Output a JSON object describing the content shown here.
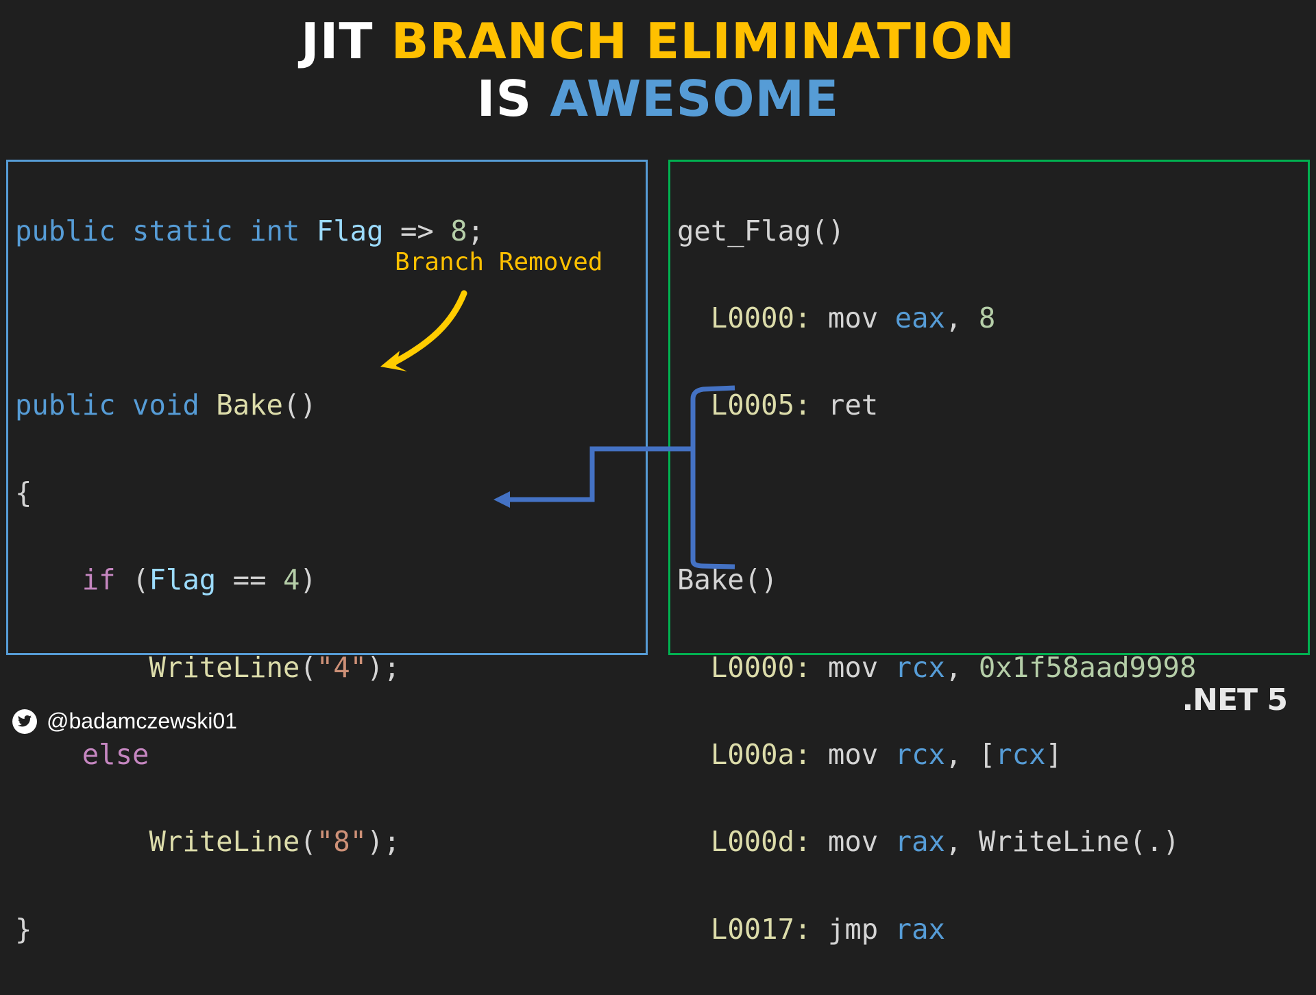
{
  "title": {
    "line1": [
      {
        "text": "JIT",
        "color": "#ffffff"
      },
      {
        "text": "BRANCH ELIMINATION",
        "color": "#ffc000"
      }
    ],
    "line2": [
      {
        "text": "IS",
        "color": "#ffffff"
      },
      {
        "text": "AWESOME",
        "color": "#569cd6"
      }
    ]
  },
  "csharp": {
    "line1": {
      "kw1": "public",
      "kw2": "static",
      "kw3": "int",
      "prop": "Flag",
      "op": "=>",
      "num": "8",
      "end": ";"
    },
    "line3": {
      "kw1": "public",
      "kw2": "void",
      "fn": "Bake",
      "parens": "()"
    },
    "open_brace": "{",
    "if_line": {
      "ctl": "if",
      "open": "(",
      "prop": "Flag",
      "op": "==",
      "num": "4",
      "close": ")"
    },
    "writeline4": {
      "fn": "WriteLine",
      "open": "(",
      "str": "\"4\"",
      "close": ");"
    },
    "else_line": "else",
    "writeline8": {
      "fn": "WriteLine",
      "open": "(",
      "str": "\"8\"",
      "close": ");"
    },
    "close_brace": "}"
  },
  "annotation": {
    "label": "Branch Removed",
    "arrow_color": "#ffcc00"
  },
  "asm": {
    "get_flag": {
      "header": "get_Flag()",
      "lines": [
        {
          "label": "L0000:",
          "op": "mov",
          "reg": "eax",
          "sep": ",",
          "arg": "8"
        },
        {
          "label": "L0005:",
          "op": "ret"
        }
      ]
    },
    "bake": {
      "header": "Bake()",
      "lines": [
        {
          "label": "L0000:",
          "op": "mov",
          "reg": "rcx",
          "sep": ",",
          "arg": "0x1f58aad9998"
        },
        {
          "label": "L000a:",
          "op": "mov",
          "reg": "rcx",
          "sep": ",",
          "open": "[",
          "arg_reg": "rcx",
          "close": "]"
        },
        {
          "label": "L000d:",
          "op": "mov",
          "reg": "rax",
          "sep": ",",
          "arg": "WriteLine(.)"
        },
        {
          "label": "L0017:",
          "op": "jmp",
          "reg": "rax"
        }
      ]
    },
    "bracket_color": "#4472c4"
  },
  "colors": {
    "background": "#1f1f1f",
    "left_box_border": "#569cd6",
    "right_box_border": "#00b050"
  },
  "footer": {
    "twitter_handle": "@badamczewski01",
    "badge": ".NET 5"
  }
}
